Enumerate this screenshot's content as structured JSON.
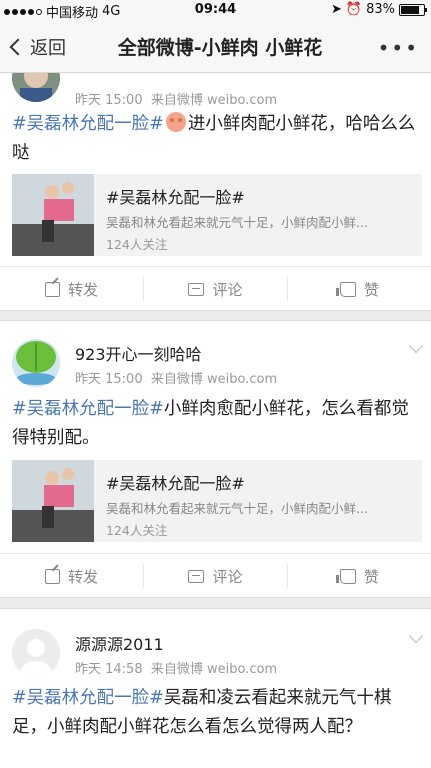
{
  "status": {
    "carrier": "中国移动",
    "network": "4G",
    "time": "09:44",
    "battery": "83%",
    "battery_level": 0.83
  },
  "nav": {
    "back_label": "返回",
    "title": "全部微博-小鲜肉 小鲜花",
    "more": "•••"
  },
  "posts": [
    {
      "time": "昨天 15:00",
      "source": "来自微博 weibo.com",
      "tag": "#吴磊林允配一脸#",
      "text": "进小鲜肉配小鲜花，哈哈么么哒",
      "repost": {
        "title": "#吴磊林允配一脸#",
        "desc": "吴磊和林允看起来就元气十足，小鲜肉配小鲜...",
        "followers": "124人关注"
      },
      "actions": {
        "forward": "转发",
        "comment": "评论",
        "like": "赞"
      }
    },
    {
      "user": "923开心一刻哈哈",
      "time": "昨天 15:00",
      "source": "来自微博 weibo.com",
      "tag": "#吴磊林允配一脸#",
      "text": "小鲜肉愈配小鲜花，怎么看都觉得特别配。",
      "repost": {
        "title": "#吴磊林允配一脸#",
        "desc": "吴磊和林允看起来就元气十足，小鲜肉配小鲜...",
        "followers": "124人关注"
      },
      "actions": {
        "forward": "转发",
        "comment": "评论",
        "like": "赞"
      }
    },
    {
      "user": "源源源2011",
      "time": "昨天 14:58",
      "source": "来自微博 weibo.com",
      "tag": "#吴磊林允配一脸#",
      "text": "吴磊和凌云看起来就元气十棋足，小鲜肉配小鲜花怎么看怎么觉得两人配？"
    }
  ]
}
